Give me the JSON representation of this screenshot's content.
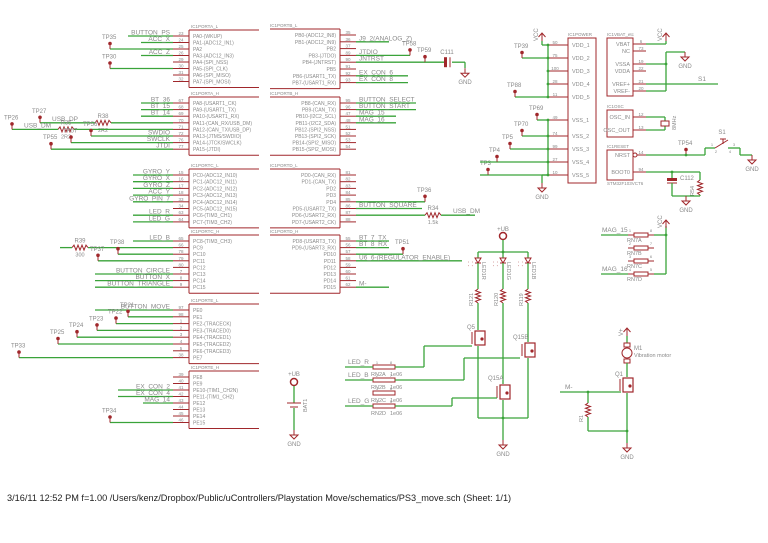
{
  "colors": {
    "part": "#a0272b",
    "wire": "#3aa33a",
    "text": "#8a8a8a"
  },
  "ics": [
    {
      "id": "porta_l",
      "title": "IC1PORTA_L",
      "pins": [
        {
          "num": "23",
          "name": "PA0-(WKUP)",
          "net": "BUTTON_PS"
        },
        {
          "num": "24",
          "name": "PA1-(ADC12_IN1)",
          "net": "ACC_X"
        },
        {
          "num": "25",
          "name": "PA2",
          "tp": "TP35"
        },
        {
          "num": "26",
          "name": "PA3-(ADC12_IN3)",
          "net": "ACC_Z"
        },
        {
          "num": "29",
          "name": "PA4-(SPI_NSS)"
        },
        {
          "num": "30",
          "name": "PA5-(SPI_CLK)",
          "tp": "TP30"
        },
        {
          "num": "31",
          "name": "PA6-(SPI_MISO)"
        },
        {
          "num": "32",
          "name": "PA7-(SPI_MOSI)"
        }
      ]
    },
    {
      "id": "porta_h",
      "title": "IC1PORTA_H",
      "pins": [
        {
          "num": "67",
          "name": "PA8-(USART1_CK)",
          "net": "BT_36"
        },
        {
          "num": "68",
          "name": "PA9-(USART1_TX)",
          "net": "BT_15"
        },
        {
          "num": "69",
          "name": "PA10-(USART1_RX)",
          "net": "BT_14"
        },
        {
          "num": "70",
          "name": "PA11-(CAN_RX/USB_DM)",
          "net": "USB_DP",
          "res": "R38",
          "res_val": "2R2",
          "tp": "TP27"
        },
        {
          "num": "71",
          "name": "PA12-(CAN_TX/USB_DP)",
          "net": "USB_DM",
          "res": "R35",
          "res_val": "2R2",
          "tp": "TP26"
        },
        {
          "num": "72",
          "name": "PA13-(JTMS/SWDIO)",
          "net": "SWDIO",
          "tp": "TP56"
        },
        {
          "num": "76",
          "name": "PA14-(JTCK/SWCLK)",
          "net": "SWCLK",
          "tp": "TP57"
        },
        {
          "num": "77",
          "name": "PA15-(JTDI)",
          "net": "JTDI",
          "tp": "TP55"
        }
      ]
    },
    {
      "id": "portc_l",
      "title": "IC1PORTC_L",
      "pins": [
        {
          "num": "15",
          "name": "PC0-(ADC12_IN10)",
          "net": "GYRO_Y"
        },
        {
          "num": "16",
          "name": "PC1-(ADC12_IN11)",
          "net": "GYRO_X"
        },
        {
          "num": "17",
          "name": "PC2-(ADC12_IN12)",
          "net": "GYRO_Z"
        },
        {
          "num": "18",
          "name": "PC3-(ADC12_IN13)",
          "net": "ACC_Y"
        },
        {
          "num": "33",
          "name": "PC4-(ADC12_IN14)",
          "net": "GYRO_PIN_7"
        },
        {
          "num": "34",
          "name": "PC5-(ADC12_IN15)"
        },
        {
          "num": "63",
          "name": "PC6-(TIM3_CH1)",
          "net": "LED_R"
        },
        {
          "num": "64",
          "name": "PC7-(TIM3_CH2)",
          "net": "LED_G"
        }
      ]
    },
    {
      "id": "portc_h",
      "title": "IC1PORTC_H",
      "pins": [
        {
          "num": "65",
          "name": "PC8-(TIM3_CH3)",
          "net": "LED_B"
        },
        {
          "num": "66",
          "name": "PC9",
          "res": "R39",
          "res_val": "300"
        },
        {
          "num": "78",
          "name": "PC10",
          "tp": "TP38"
        },
        {
          "num": "79",
          "name": "PC11",
          "tp": "TP37"
        },
        {
          "num": "80",
          "name": "PC12"
        },
        {
          "num": "7",
          "name": "PC13",
          "net": "BUTTON_CIRCLE"
        },
        {
          "num": "8",
          "name": "PC14",
          "net": "BUTTON_X"
        },
        {
          "num": "9",
          "name": "PC15",
          "net": "BUTTON_TRIANGLE"
        }
      ]
    },
    {
      "id": "porte_l",
      "title": "IC1PORTE_L",
      "pins": [
        {
          "num": "97",
          "name": "PE0",
          "net": "BUTTON_MOVE"
        },
        {
          "num": "98",
          "name": "PE1",
          "tp": "TP21"
        },
        {
          "num": "1",
          "name": "PE2-(TRACECK)",
          "tp": "TP22"
        },
        {
          "num": "2",
          "name": "PE3-(TRACED0)",
          "tp": "TP23"
        },
        {
          "num": "3",
          "name": "PE4-(TRACED1)",
          "tp": "TP24"
        },
        {
          "num": "4",
          "name": "PE5-(TRACED2)",
          "tp": "TP25"
        },
        {
          "num": "5",
          "name": "PE6-(TRACED3)"
        },
        {
          "num": "38",
          "name": "PE7",
          "tp": "TP33"
        }
      ]
    },
    {
      "id": "porte_h",
      "title": "IC1PORTE_H",
      "pins": [
        {
          "num": "39",
          "name": "PE8"
        },
        {
          "num": "40",
          "name": "PE9"
        },
        {
          "num": "41",
          "name": "PE10-(TIM1_CH2N)",
          "net": "EX_CON_2"
        },
        {
          "num": "42",
          "name": "PE11-(TIM1_CH2)",
          "net": "EX_CON_4"
        },
        {
          "num": "43",
          "name": "PE12",
          "net": "MAG_14"
        },
        {
          "num": "44",
          "name": "PE13"
        },
        {
          "num": "45",
          "name": "PE14"
        },
        {
          "num": "46",
          "name": "PE15",
          "tp": "TP34"
        }
      ]
    },
    {
      "id": "portb_l",
      "title": "IC1PORTB_L",
      "pins": [
        {
          "num": "35",
          "name": "PB0-(ADC12_IN8)"
        },
        {
          "num": "36",
          "name": "PB1-(ADC12_IN9)",
          "net": "J9_2(ANALOG_Z)"
        },
        {
          "num": "37",
          "name": "PB2"
        },
        {
          "num": "89",
          "name": "PB3-(JTDO)",
          "net": "JTDIO",
          "tp": "TP58"
        },
        {
          "num": "90",
          "name": "PB4-(JNTRST)",
          "net": "JNTRST",
          "tp": "TP59"
        },
        {
          "num": "91",
          "name": "PB5"
        },
        {
          "num": "92",
          "name": "PB6-(USART1_TX)",
          "net": "EX_CON_6"
        },
        {
          "num": "93",
          "name": "PB7-(USART1_RX)",
          "net": "EX_CON_8"
        }
      ]
    },
    {
      "id": "portb_h",
      "title": "IC1PORTB_H",
      "pins": [
        {
          "num": "95",
          "name": "PB8-(CAN_RX)",
          "net": "BUTTON_SELECT"
        },
        {
          "num": "96",
          "name": "PB9-(CAN_TX)",
          "net": "BUTTON_START"
        },
        {
          "num": "47",
          "name": "PB10-(I2C2_SCL)",
          "net": "MAG_15"
        },
        {
          "num": "48",
          "name": "PB11-(I2C2_SDA)",
          "net": "MAG_16"
        },
        {
          "num": "51",
          "name": "PB12-(SPI2_NSS)"
        },
        {
          "num": "52",
          "name": "PB13-(SPI2_SCK)"
        },
        {
          "num": "53",
          "name": "PB14-(SPI2_MISO)"
        },
        {
          "num": "54",
          "name": "PB15-(SPI2_MOSI)"
        }
      ]
    },
    {
      "id": "portd_l",
      "title": "IC1PORTD_L",
      "pins": [
        {
          "num": "81",
          "name": "PD0-(CAN_RX)"
        },
        {
          "num": "82",
          "name": "PD1-(CAN_TX)"
        },
        {
          "num": "83",
          "name": "PD2"
        },
        {
          "num": "84",
          "name": "PD3"
        },
        {
          "num": "85",
          "name": "PD4",
          "tp": "TP36"
        },
        {
          "num": "86",
          "name": "PD5-(USART2_TX)",
          "net": "BUTTON_SQUARE"
        },
        {
          "num": "87",
          "name": "PD6-(USART2_RX)",
          "net": "USB_DM",
          "res": "R34",
          "res_val": "1.5k"
        },
        {
          "num": "88",
          "name": "PD7-(USART2_CK)"
        }
      ]
    },
    {
      "id": "portd_h",
      "title": "IC1PORTD_H",
      "pins": [
        {
          "num": "55",
          "name": "PD8-(USART3_TX)",
          "net": "BT_7_TX"
        },
        {
          "num": "56",
          "name": "PD9-(USART3_RX)",
          "net": "BT_8_RX"
        },
        {
          "num": "57",
          "name": "PD10",
          "tp": "TP51"
        },
        {
          "num": "58",
          "name": "PD11",
          "net": "U6_6-(REGULATOR_ENABLE)"
        },
        {
          "num": "59",
          "name": "PD12"
        },
        {
          "num": "60",
          "name": "PD13"
        },
        {
          "num": "61",
          "name": "PD14"
        },
        {
          "num": "62",
          "name": "PD15",
          "net": "M-"
        }
      ]
    },
    {
      "id": "power",
      "title": "IC1POWER",
      "pins": [
        {
          "num": "50",
          "name": "VDD_1"
        },
        {
          "num": "75",
          "name": "VDD_2",
          "tp": "TP39"
        },
        {
          "num": "100",
          "name": "VDD_3"
        },
        {
          "num": "28",
          "name": "VDD_4"
        },
        {
          "num": "11",
          "name": "VDD_5",
          "tp": "TP88"
        },
        {
          "num": "49",
          "name": "VSS_1",
          "tp": "TP69"
        },
        {
          "num": "74",
          "name": "VSS_2",
          "tp": "TP70"
        },
        {
          "num": "99",
          "name": "VSS_3",
          "tp": "TP5"
        },
        {
          "num": "27",
          "name": "VSS_4",
          "tp": "TP4"
        },
        {
          "num": "10",
          "name": "VSS_5",
          "tp": "TP3"
        }
      ]
    },
    {
      "id": "vbat",
      "title": "IC1VBAT_etc",
      "pins": [
        {
          "num": "6",
          "name": "VBAT"
        },
        {
          "num": "73",
          "name": "NC"
        },
        {
          "num": "19",
          "name": "VSSA"
        },
        {
          "num": "22",
          "name": "VDDA"
        },
        {
          "num": "21",
          "name": "VREF+",
          "net": "S1"
        },
        {
          "num": "20",
          "name": "VREF-"
        }
      ]
    },
    {
      "id": "osc",
      "title": "IC1OSC",
      "pins": [
        {
          "num": "12",
          "name": "OSC_IN"
        },
        {
          "num": "13",
          "name": "OSC_OUT"
        }
      ]
    },
    {
      "id": "reset",
      "title": "IC1RESET",
      "part": "STM32F103VCT6",
      "pins": [
        {
          "num": "14",
          "name": "NRST",
          "tp": "TP54"
        },
        {
          "num": "94",
          "name": "BOOT0"
        }
      ]
    }
  ],
  "components": {
    "gnd": "GND",
    "vcc": "VCC",
    "vplus": "V+",
    "ub": "+UB",
    "c111": "C111",
    "c112": "C112",
    "r54": "R54",
    "crystal": "8MHz",
    "switch": "S1",
    "switch_pins": [
      "1",
      "2",
      "3",
      "4"
    ],
    "leds": [
      "LED1R",
      "LED1G",
      "LED1B"
    ],
    "led_res": [
      "R121",
      "R120",
      "R119"
    ],
    "fets": [
      "Q5",
      "Q15A",
      "Q15B"
    ],
    "rn2": [
      {
        "name": "RN2A",
        "value": "1e06",
        "net": "LED_R",
        "p1": "1",
        "p2": "8"
      },
      {
        "name": "RN2B",
        "value": "1e06",
        "net": "LED_B",
        "p1": "2",
        "p2": "7"
      },
      {
        "name": "RN2C",
        "value": "1e06",
        "net": "",
        "p1": "3",
        "p2": "6"
      },
      {
        "name": "RN2D",
        "value": "1e06",
        "net": "LED_G",
        "p1": "4",
        "p2": "5"
      }
    ],
    "battery": "BAT1",
    "rn7": [
      {
        "name": "RN7A",
        "net": "MAG_15",
        "p1": "1",
        "p2": "8"
      },
      {
        "name": "RN7B",
        "net": "",
        "p1": "2",
        "p2": "7"
      },
      {
        "name": "RN7C",
        "net": "",
        "p1": "3",
        "p2": "6"
      },
      {
        "name": "RN7D",
        "net": "MAG_16",
        "p1": "4",
        "p2": "5"
      }
    ],
    "motor": "M1",
    "motor_desc": "Vibration motor",
    "q1": "Q1",
    "motor_net": "M-",
    "r1": "R1"
  },
  "footer": "3/16/11 12:52 PM  f=1.00  /Users/kenz/Dropbox/Public/uControllers/Playstation Move/schematics/PS3_move.sch (Sheet: 1/1)"
}
